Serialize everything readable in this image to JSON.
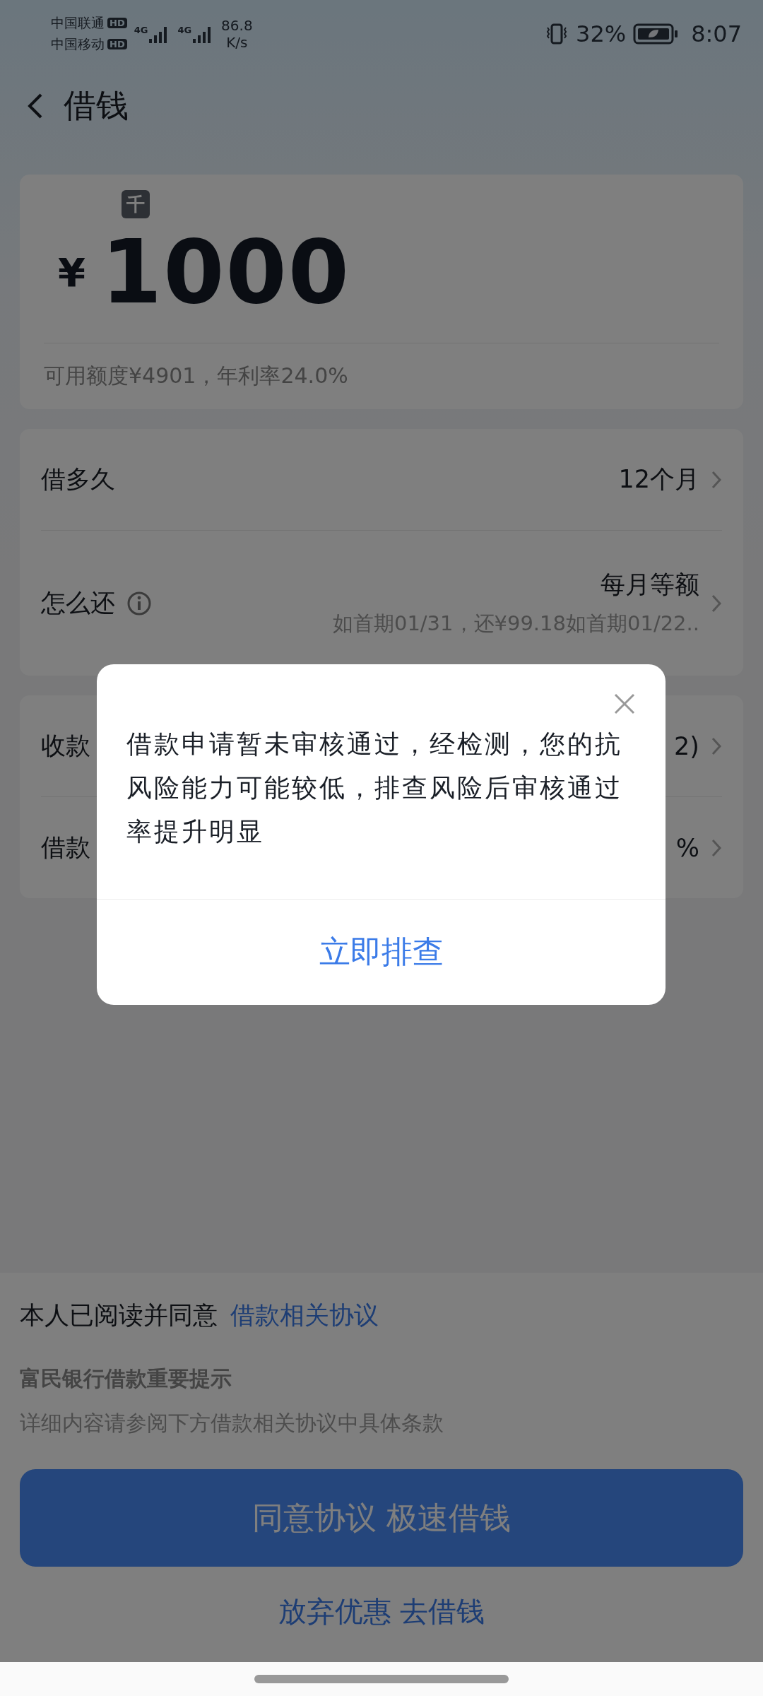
{
  "status_bar": {
    "carriers": [
      {
        "name": "中国联通",
        "badge": "HD"
      },
      {
        "name": "中国移动",
        "badge": "HD"
      }
    ],
    "networks": [
      "4G",
      "4G"
    ],
    "speed": "86.8",
    "speed_unit": "K/s",
    "battery": "32%",
    "time": "8:07"
  },
  "nav": {
    "title": "借钱"
  },
  "amount": {
    "unit_badge": "千",
    "currency": "¥",
    "value": "1000",
    "note": "可用额度¥4901，年利率24.0%"
  },
  "groups": [
    {
      "rows": [
        {
          "label": "借多久",
          "value": "12个月",
          "info_icon": false
        },
        {
          "label": "怎么还",
          "value": "每月等额",
          "sub": "如首期01/31，还¥99.18如首期01/22..",
          "info_icon": true
        }
      ]
    },
    {
      "rows": [
        {
          "label": "收款",
          "value": "2)"
        },
        {
          "label": "借款",
          "value": "%"
        }
      ]
    }
  ],
  "agreement": {
    "prefix": "本人已阅读并同意",
    "link": "借款相关协议"
  },
  "notice": {
    "title": "富民银行借款重要提示",
    "body": "详细内容请参阅下方借款相关协议中具体条款"
  },
  "primary_button": "同意协议 极速借钱",
  "secondary_link": "放弃优惠 去借钱",
  "dialog": {
    "message": "借款申请暂未审核通过，经检测，您的抗风险能力可能较低，排查风险后审核通过率提升明显",
    "action": "立即排查"
  }
}
